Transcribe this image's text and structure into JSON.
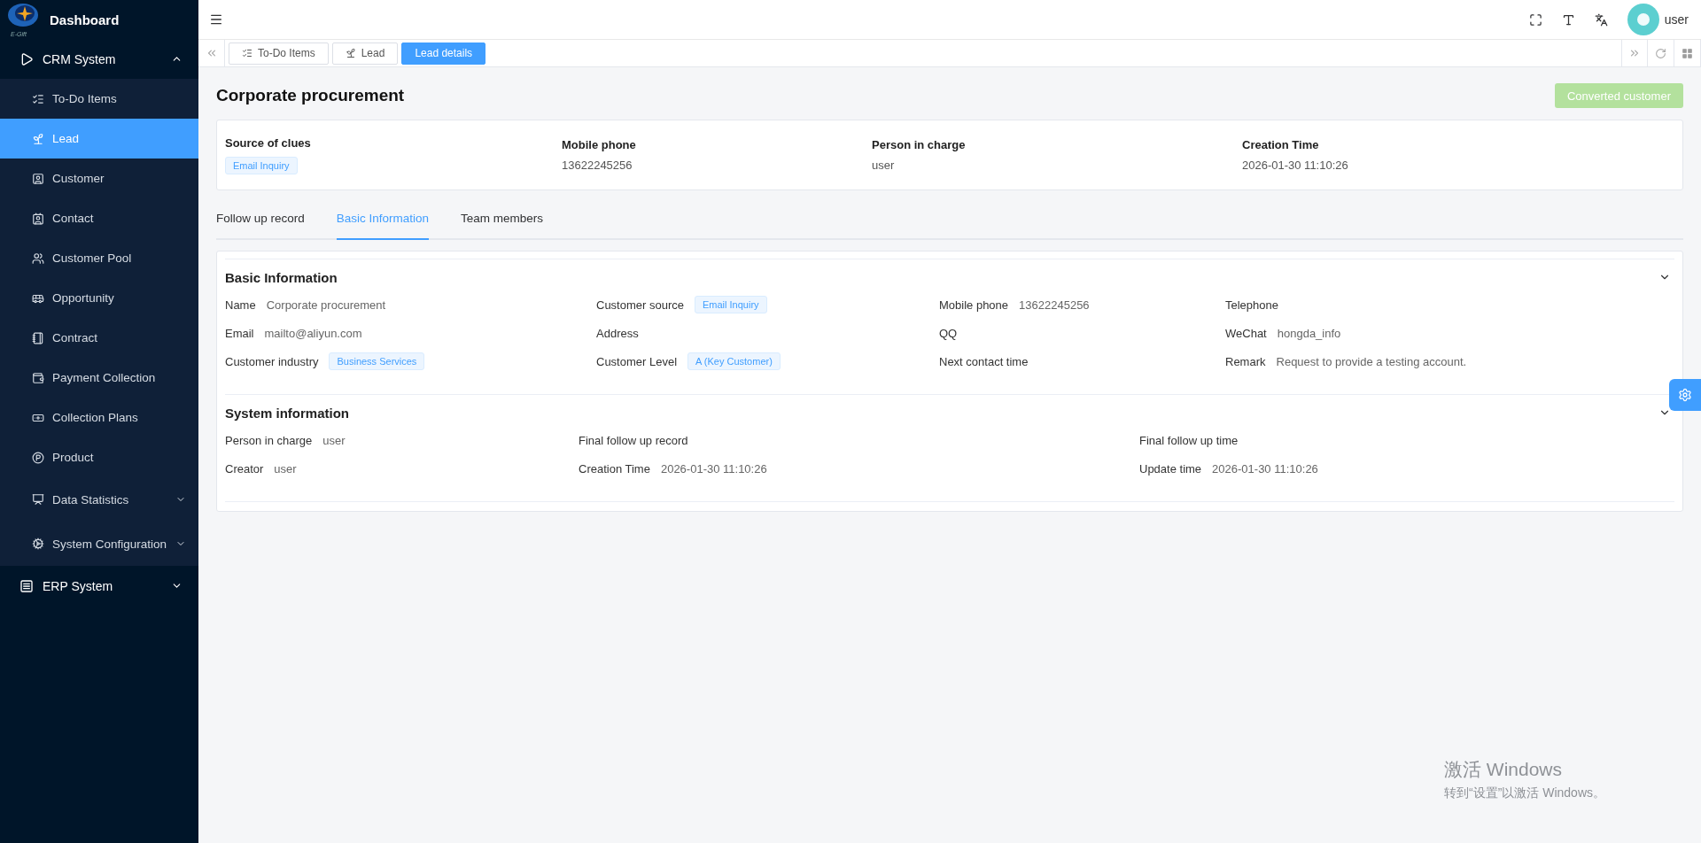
{
  "sidebar": {
    "title": "Dashboard",
    "logo_caption": "E-Gift",
    "items": [
      {
        "label": "CRM System",
        "expanded": true,
        "selected": false,
        "children": [
          {
            "label": "To-Do Items",
            "kind": "link",
            "selected": false
          },
          {
            "label": "Lead",
            "kind": "link",
            "selected": true
          },
          {
            "label": "Customer",
            "kind": "link",
            "selected": false
          },
          {
            "label": "Contact",
            "kind": "link",
            "selected": false
          },
          {
            "label": "Customer Pool",
            "kind": "link",
            "selected": false
          },
          {
            "label": "Opportunity",
            "kind": "link",
            "selected": false
          },
          {
            "label": "Contract",
            "kind": "link",
            "selected": false
          },
          {
            "label": "Payment Collection",
            "kind": "link",
            "selected": false
          },
          {
            "label": "Collection Plans",
            "kind": "link",
            "selected": false
          },
          {
            "label": "Product",
            "kind": "link",
            "selected": false
          },
          {
            "label": "Data Statistics",
            "kind": "submenu",
            "expanded": false,
            "selected": false
          },
          {
            "label": "System Configuration",
            "kind": "submenu",
            "expanded": false,
            "selected": false
          }
        ]
      },
      {
        "label": "ERP System",
        "expanded": false,
        "selected": false
      }
    ]
  },
  "header": {
    "user": "user"
  },
  "page_tabs": [
    {
      "label": "To-Do Items",
      "selected": false
    },
    {
      "label": "Lead",
      "selected": false
    },
    {
      "label": "Lead details",
      "selected": true
    }
  ],
  "title": "Corporate procurement",
  "convert_button": {
    "label": "Converted customer",
    "disabled": true
  },
  "summary": [
    {
      "label": "Source of clues",
      "value": "Email Inquiry",
      "kind": "tag"
    },
    {
      "label": "Mobile phone",
      "value": "13622245256",
      "kind": "text"
    },
    {
      "label": "Person in charge",
      "value": "user",
      "kind": "text"
    },
    {
      "label": "Creation Time",
      "value": "2026-01-30 11:10:26",
      "kind": "text"
    }
  ],
  "detail_tabs": [
    {
      "label": "Follow up record",
      "selected": false
    },
    {
      "label": "Basic Information",
      "selected": true
    },
    {
      "label": "Team members",
      "selected": false
    }
  ],
  "sections": [
    {
      "title": "Basic Information",
      "expanded": true,
      "fields": [
        {
          "label": "Name",
          "value": "Corporate procurement",
          "kind": "text"
        },
        {
          "label": "Customer source",
          "value": "Email Inquiry",
          "kind": "tag"
        },
        {
          "label": "Mobile phone",
          "value": "13622245256",
          "kind": "text"
        },
        {
          "label": "Telephone"
        },
        {
          "label": "Email",
          "value": "mailto@aliyun.com",
          "kind": "text"
        },
        {
          "label": "Address"
        },
        {
          "label": "QQ"
        },
        {
          "label": "WeChat",
          "value": "hongda_info",
          "kind": "text"
        },
        {
          "label": "Customer industry",
          "value": "Business Services",
          "kind": "tag"
        },
        {
          "label": "Customer Level",
          "value": "A (Key Customer)",
          "kind": "tag"
        },
        {
          "label": "Next contact time"
        },
        {
          "label": "Remark",
          "value": "Request to provide a testing account.",
          "kind": "text"
        }
      ]
    },
    {
      "title": "System information",
      "expanded": true,
      "fields": [
        {
          "label": "Person in charge",
          "value": "user",
          "kind": "text"
        },
        {
          "label": "Final follow up record"
        },
        {
          "label": "Final follow up time"
        },
        {
          "label": "Creator",
          "value": "user",
          "kind": "text"
        },
        {
          "label": "Creation Time",
          "value": "2026-01-30 11:10:26",
          "kind": "text"
        },
        {
          "label": "Update time",
          "value": "2026-01-30 11:10:26",
          "kind": "text"
        }
      ]
    }
  ],
  "os_notice": {
    "title": "激活 Windows",
    "text": "转到“设置”以激活 Windows。"
  }
}
